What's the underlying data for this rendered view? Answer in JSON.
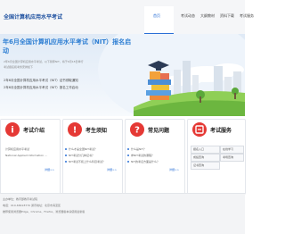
{
  "header": {
    "title": "全国计算机应用水平考试",
    "nav": [
      "首页",
      "考试动态",
      "大纲教材",
      "资料下载",
      "考试服务"
    ]
  },
  "banner": {
    "headline": "年6月全国计算机应用水平考试（NIT）报名启动",
    "desc1": "2年6月全国计算机应用水平考试，以下简称NIT，将于6月18日举行",
    "desc2": "考试报名和考务安排如下",
    "notice1": "2年6月全国计算机应用水平考试（NIT）证书领取通知",
    "notice2": "2年6月全国计算机应用水平考试（NIT）报名工作启动"
  },
  "panels": {
    "intro": {
      "title": "考试介绍",
      "items": [
        "计算机应用水平考试",
        "National Applied Information ..."
      ],
      "more": "详细>>"
    },
    "guide": {
      "title": "考生须知",
      "items": [
        "什么才是全国NIT考试？",
        "NIT考试分几种证书？",
        "NIT考试不和上什么科目考试？"
      ],
      "more": "详细>>"
    },
    "faq": {
      "title": "常见问题",
      "items": [
        "什么是NIT？",
        "参NIT考试的课程？",
        "NIT的考证方面是什么？"
      ],
      "more": "详细>>"
    },
    "service": {
      "title": "考试服务",
      "buttons": [
        "报名入口",
        "成绩查询",
        "证书查询",
        "在线学习",
        "考场查询"
      ]
    }
  },
  "footer": {
    "line1": "主办单位：教育部教育考试院",
    "line2": "电话：010-68418770  通讯地址：北京市海淀区",
    "line3": "推荐使用浏览器Edge、Chrome、Firefox，浏览器版本请使用最新版"
  },
  "colors": {
    "brand": "#1c4f9f",
    "accent": "#2a6fd6",
    "intro": "#e53935",
    "guide": "#e53935",
    "faq": "#e53935",
    "service": "#e53935"
  }
}
